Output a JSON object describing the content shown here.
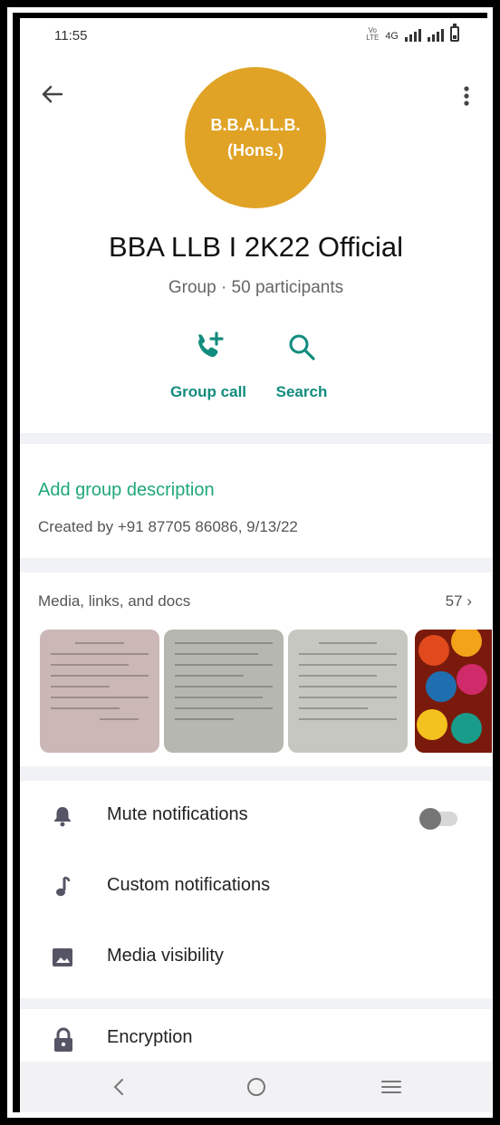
{
  "status_bar": {
    "time": "11:55",
    "volte": "VoLTE",
    "network": "4G"
  },
  "profile": {
    "avatar_line1": "B.B.A.LL.B.",
    "avatar_line2": "(Hons.)",
    "avatar_color": "#e0a326",
    "name": "BBA LLB I 2K22 Official",
    "subtitle": "Group · 50 participants"
  },
  "actions": {
    "group_call_label": "Group call",
    "search_label": "Search"
  },
  "description": {
    "add_label": "Add group description",
    "created": "Created by +91 87705 86086, 9/13/22"
  },
  "media": {
    "header": "Media, links, and docs",
    "count": "57",
    "thumbnails": [
      "document-photo",
      "document-photo",
      "document-photo",
      "diya-photo"
    ]
  },
  "settings": {
    "mute_label": "Mute notifications",
    "mute_enabled": false,
    "custom_label": "Custom notifications",
    "visibility_label": "Media visibility",
    "encryption_label": "Encryption"
  },
  "colors": {
    "accent": "#128c7e",
    "link": "#1ea878"
  }
}
